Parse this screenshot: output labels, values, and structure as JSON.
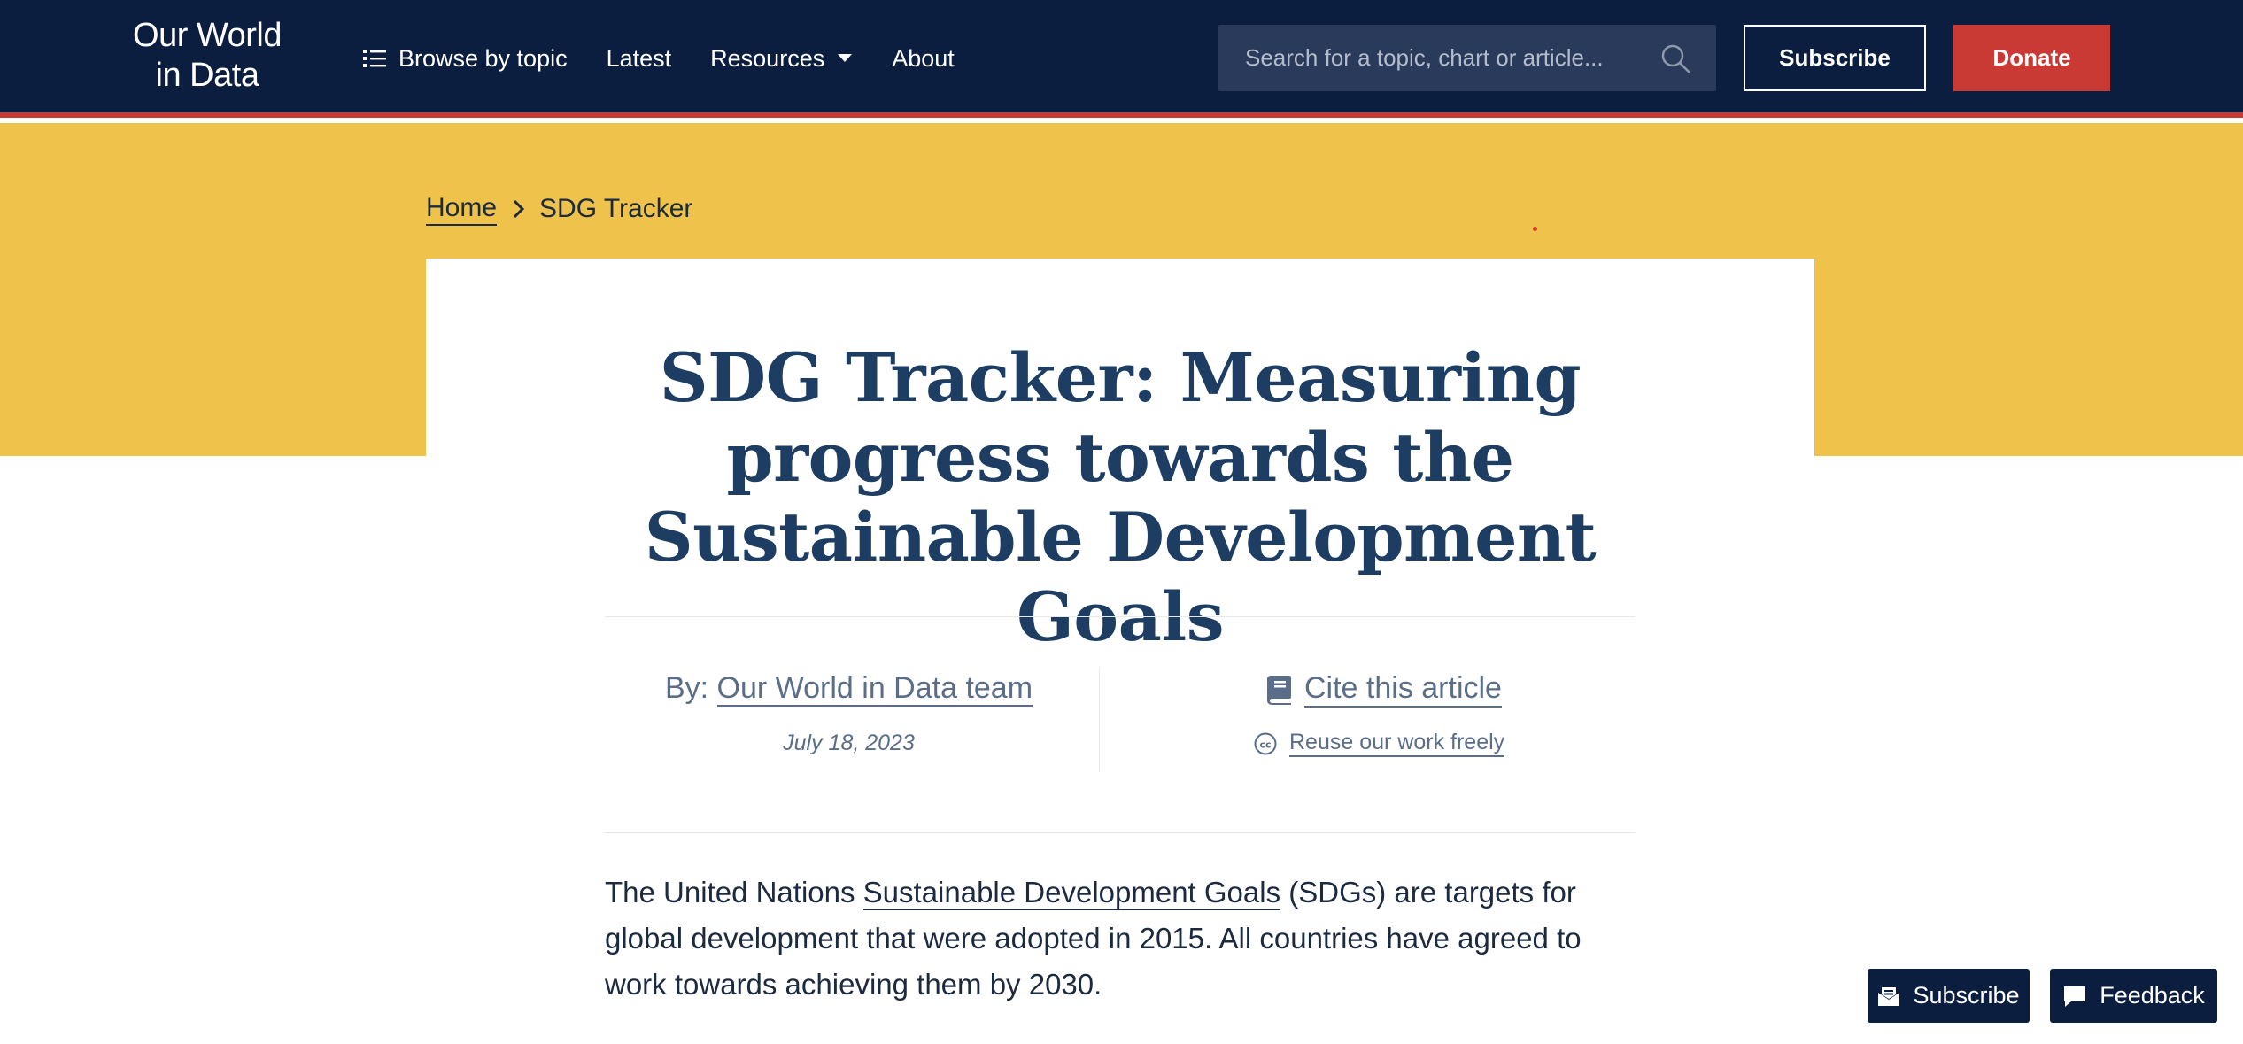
{
  "header": {
    "logo_line1": "Our World",
    "logo_line2": "in Data",
    "nav": {
      "browse": "Browse by topic",
      "latest": "Latest",
      "resources": "Resources",
      "about": "About"
    },
    "search_placeholder": "Search for a topic, chart or article...",
    "subscribe_label": "Subscribe",
    "donate_label": "Donate"
  },
  "breadcrumb": {
    "home": "Home",
    "current": "SDG Tracker"
  },
  "article": {
    "title": "SDG Tracker: Measuring progress towards the Sustainable Development Goals",
    "by_prefix": "By: ",
    "author": "Our World in Data team",
    "date": "July 18, 2023",
    "cite_label": "Cite this article",
    "reuse_label": "Reuse our work freely",
    "intro_before": "The United Nations ",
    "intro_link": "Sustainable Development Goals",
    "intro_after": " (SDGs) are targets for global development that were adopted in 2015. All countries have agreed to work towards achieving them by 2030."
  },
  "floating": {
    "subscribe_label": "Subscribe",
    "feedback_label": "Feedback"
  },
  "colors": {
    "header_bg": "#0c1e3f",
    "accent_red": "#c83a33",
    "band_yellow": "#eec24b",
    "title_blue": "#1d3d63"
  }
}
